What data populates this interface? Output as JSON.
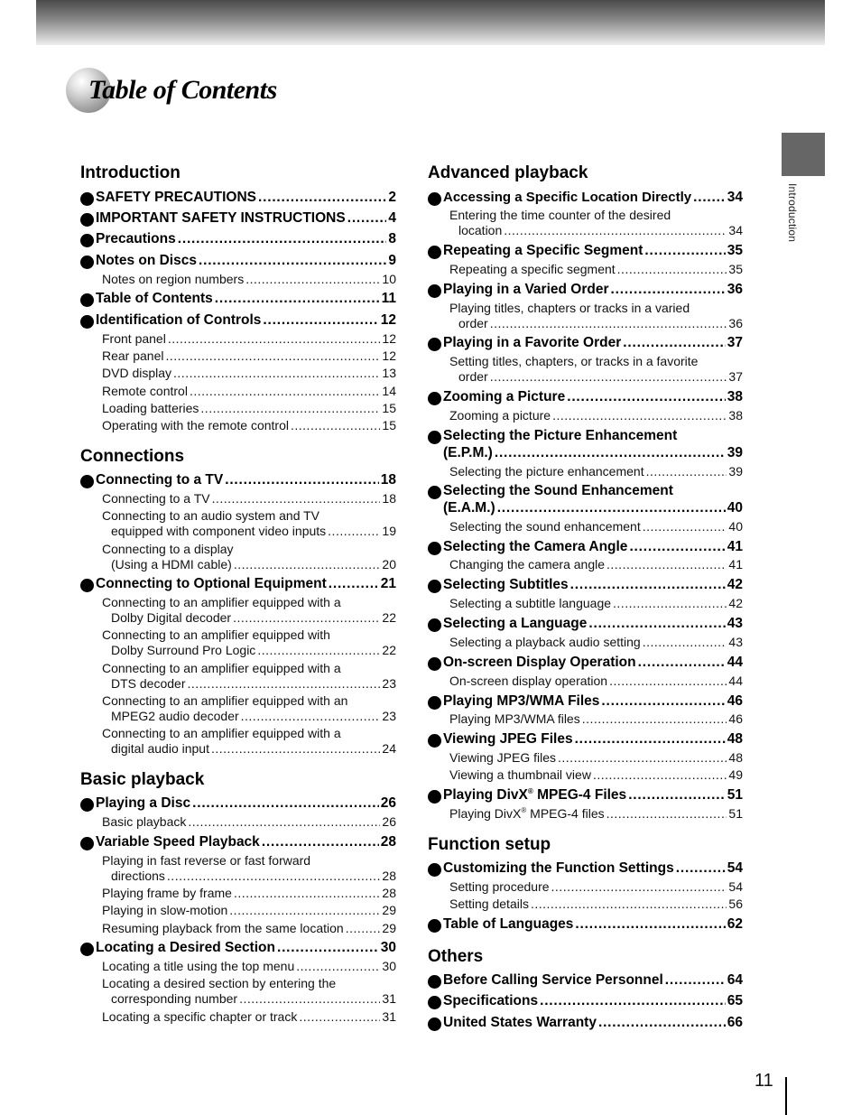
{
  "page": {
    "title": "Table of Contents",
    "side_tab_label": "Introduction",
    "page_number": "11"
  },
  "colors": {
    "header_dark": "#4a4a4a",
    "side_tab": "#666666",
    "text": "#000000"
  },
  "left_column": {
    "introduction": {
      "heading": "Introduction",
      "entries": [
        {
          "text": "SAFETY PRECAUTIONS",
          "page": "2"
        },
        {
          "text": "IMPORTANT SAFETY INSTRUCTIONS",
          "page": "4"
        },
        {
          "text": "Precautions",
          "page": "8"
        },
        {
          "text": "Notes on Discs",
          "page": "9"
        },
        {
          "text": "Notes on region numbers",
          "page": "10"
        },
        {
          "text": "Table of Contents",
          "page": "11"
        },
        {
          "text": "Identification of Controls",
          "page": "12"
        },
        {
          "text": "Front panel",
          "page": "12"
        },
        {
          "text": "Rear panel",
          "page": "12"
        },
        {
          "text": "DVD display",
          "page": "13"
        },
        {
          "text": "Remote control",
          "page": "14"
        },
        {
          "text": "Loading batteries",
          "page": "15"
        },
        {
          "text": "Operating with the remote control",
          "page": "15"
        }
      ]
    },
    "connections": {
      "heading": "Connections",
      "entries": [
        {
          "text": "Connecting to a TV",
          "page": "18"
        },
        {
          "text": "Connecting to a TV",
          "page": "18"
        },
        {
          "line1": "Connecting to an audio system and TV",
          "text": "equipped with component video inputs",
          "page": "19"
        },
        {
          "line1": "Connecting to a display",
          "text": "(Using a HDMI cable)",
          "page": "20"
        },
        {
          "text": "Connecting to Optional Equipment",
          "page": "21"
        },
        {
          "line1": "Connecting to an amplifier equipped with a",
          "text": "Dolby Digital decoder",
          "page": "22"
        },
        {
          "line1": "Connecting to an amplifier equipped with",
          "text": "Dolby Surround Pro Logic",
          "page": "22"
        },
        {
          "line1": "Connecting to an amplifier equipped with a",
          "text": "DTS decoder",
          "page": "23"
        },
        {
          "line1": "Connecting to an amplifier equipped with an",
          "text": "MPEG2 audio decoder",
          "page": "23"
        },
        {
          "line1": "Connecting to an amplifier equipped with a",
          "text": "digital audio input",
          "page": "24"
        }
      ]
    },
    "basic_playback": {
      "heading": "Basic playback",
      "entries": [
        {
          "text": "Playing a Disc",
          "page": "26"
        },
        {
          "text": "Basic playback",
          "page": "26"
        },
        {
          "text": "Variable Speed Playback",
          "page": "28"
        },
        {
          "line1": "Playing in fast reverse or fast forward",
          "text": "directions",
          "page": "28"
        },
        {
          "text": "Playing frame by frame",
          "page": "28"
        },
        {
          "text": "Playing in slow-motion",
          "page": "29"
        },
        {
          "text": "Resuming playback from the same location",
          "page": "29"
        },
        {
          "text": "Locating a Desired Section",
          "page": "30"
        },
        {
          "text": "Locating a title using the top menu",
          "page": "30"
        },
        {
          "line1": "Locating a desired section by entering the",
          "text": "corresponding number",
          "page": "31"
        },
        {
          "text": "Locating a specific chapter or track",
          "page": "31"
        }
      ]
    }
  },
  "right_column": {
    "advanced_playback": {
      "heading": "Advanced playback",
      "entries": [
        {
          "text": "Accessing a Specific Location Directly",
          "page": "34"
        },
        {
          "line1": "Entering the time counter of the desired",
          "text": "location",
          "page": "34"
        },
        {
          "text": "Repeating a Specific Segment",
          "page": "35"
        },
        {
          "text": "Repeating a specific segment",
          "page": "35"
        },
        {
          "text": "Playing in a Varied Order",
          "page": "36"
        },
        {
          "line1": "Playing titles, chapters or tracks in a varied",
          "text": "order",
          "page": "36"
        },
        {
          "text": "Playing in a Favorite Order",
          "page": "37"
        },
        {
          "line1": "Setting titles, chapters, or tracks in a favorite",
          "text": "order",
          "page": "37"
        },
        {
          "text": "Zooming a Picture",
          "page": "38"
        },
        {
          "text": "Zooming a picture",
          "page": "38"
        },
        {
          "line1": "Selecting the Picture Enhancement",
          "text": "(E.P.M.)",
          "page": "39"
        },
        {
          "text": "Selecting the picture enhancement",
          "page": "39"
        },
        {
          "line1": "Selecting the Sound Enhancement",
          "text": "(E.A.M.)",
          "page": "40"
        },
        {
          "text": "Selecting the sound enhancement",
          "page": "40"
        },
        {
          "text": "Selecting the Camera Angle",
          "page": "41"
        },
        {
          "text": "Changing the camera angle",
          "page": "41"
        },
        {
          "text": "Selecting Subtitles",
          "page": "42"
        },
        {
          "text": "Selecting a subtitle language",
          "page": "42"
        },
        {
          "text": "Selecting a Language",
          "page": "43"
        },
        {
          "text": "Selecting a playback audio setting",
          "page": "43"
        },
        {
          "text": "On-screen Display Operation",
          "page": "44"
        },
        {
          "text": "On-screen display operation",
          "page": "44"
        },
        {
          "text": "Playing MP3/WMA Files",
          "page": "46"
        },
        {
          "text": "Playing MP3/WMA files",
          "page": "46"
        },
        {
          "text": "Viewing JPEG Files",
          "page": "48"
        },
        {
          "text": "Viewing JPEG files",
          "page": "48"
        },
        {
          "text": "Viewing a thumbnail view",
          "page": "49"
        },
        {
          "text_a": "Playing DivX",
          "sup": "®",
          "text_b": " MPEG-4 Files",
          "page": "51"
        },
        {
          "text_a": "Playing DivX",
          "sup": "®",
          "text_b": " MPEG-4 files",
          "page": "51"
        }
      ]
    },
    "function_setup": {
      "heading": "Function setup",
      "entries": [
        {
          "text": "Customizing the Function Settings",
          "page": "54"
        },
        {
          "text": "Setting procedure",
          "page": "54"
        },
        {
          "text": "Setting details",
          "page": "56"
        },
        {
          "text": "Table of Languages",
          "page": "62"
        }
      ]
    },
    "others": {
      "heading": "Others",
      "entries": [
        {
          "text": "Before Calling Service Personnel",
          "page": "64"
        },
        {
          "text": "Specifications",
          "page": "65"
        },
        {
          "text": "United States Warranty",
          "page": "66"
        }
      ]
    }
  }
}
